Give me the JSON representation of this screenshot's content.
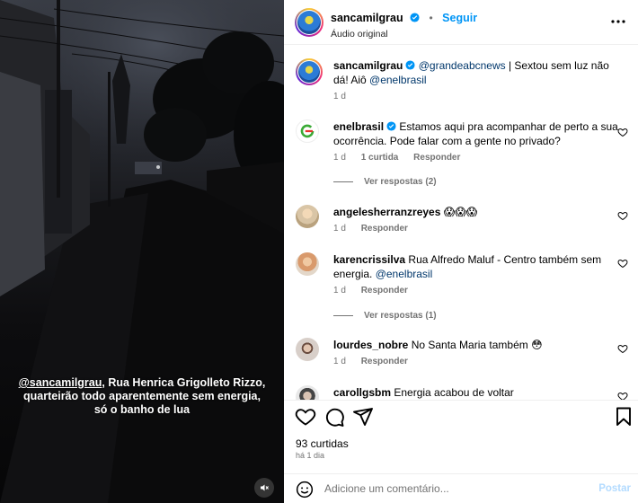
{
  "media": {
    "caption_mention": "@sancamilgrau",
    "caption_text": ", Rua Henrica Grigolleto Rizzo, quarteirão todo aparentemente sem energia, só o banho de lua",
    "mute_icon": "volume-off-icon"
  },
  "header": {
    "username": "sancamilgrau",
    "follow_label": "Seguir",
    "audio": "Áudio original",
    "separator": "•"
  },
  "caption_post": {
    "username": "sancamilgrau",
    "mention1": "@grandeabcnews",
    "text": " | Sextou sem luz não dá! Aiô ",
    "mention2": "@enelbrasil",
    "time": "1 d"
  },
  "comments": [
    {
      "username": "enelbrasil",
      "text": " Estamos aqui pra acompanhar de perto a sua ocorrência. Pode falar com a gente no privado?",
      "time": "1 d",
      "likes": "1 curtida",
      "reply": "Responder",
      "view_replies": "Ver respostas (2)"
    },
    {
      "username": "angelesherranzreyes",
      "text": " 😱😱😱",
      "time": "1 d",
      "reply": "Responder"
    },
    {
      "username": "karencrissilva",
      "text": " Rua Alfredo Maluf - Centro também sem energia. ",
      "mention": "@enelbrasil",
      "time": "1 d",
      "reply": "Responder",
      "view_replies": "Ver respostas (1)"
    },
    {
      "username": "lourdes_nobre",
      "text": " No Santa Maria também 😳",
      "time": "1 d",
      "reply": "Responder"
    },
    {
      "username": "carollgsbm",
      "text": " Energia acabou de voltar"
    }
  ],
  "actions": {
    "likes": "93 curtidas",
    "time": "há 1 dia",
    "comment_placeholder": "Adicione um comentário...",
    "post_label": "Postar"
  }
}
